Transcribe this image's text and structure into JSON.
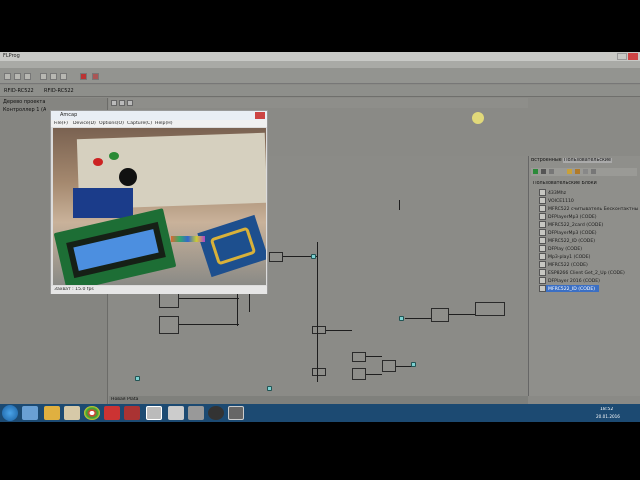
{
  "app": {
    "title": "FLProg",
    "window_controls": [
      "minimize-icon",
      "maximize-icon",
      "close-icon"
    ]
  },
  "tabs": [
    {
      "label": "RFID-RC522"
    },
    {
      "label": "RFID-RC522"
    }
  ],
  "project_tree": {
    "header": "Дерево проекта",
    "item": "Контроллер 1 (A"
  },
  "camera_window": {
    "title": "Amcap",
    "menu": [
      "File(F)",
      "Device(D)",
      "Options(O)",
      "Capture(C)",
      "Help(H)"
    ],
    "status": "Захват : 15.0 fps"
  },
  "right_panel": {
    "tabs": [
      "Встроенные",
      "Пользовательские"
    ],
    "root": "Пользовательские Блоки",
    "items": [
      "433Mhz",
      "VOICE1110",
      "MFRC522 считыватель Бесконтактны",
      "DFPlayerMp3 (CODE)",
      "MFRC522_2card (CODE)",
      "DFPlayerMp3 (CODE)",
      "MFRC522_ID (CODE)",
      "DFPlay (CODE)",
      "Mp3-play1 (CODE)",
      "MFRC522 (CODE)",
      "ESP8266 Client Get_2_Up (CODE)",
      "DFPlayer 2016 (CODE)",
      "MFRC522_ID (CODE)"
    ],
    "selected_index": 12
  },
  "canvas": {
    "bottom_tab": "Новая Plata"
  },
  "taskbar": {
    "clock_time": "18:52",
    "clock_date": "20.01.2016"
  }
}
